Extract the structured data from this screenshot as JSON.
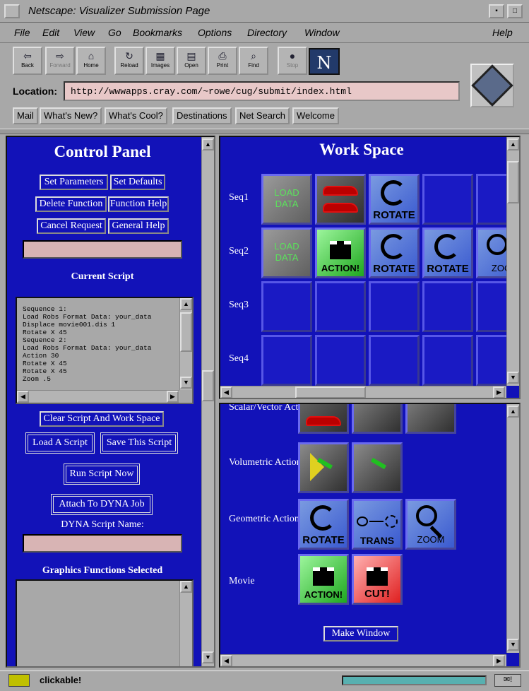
{
  "window": {
    "title": "Netscape: Visualizer Submission Page"
  },
  "menu": [
    "File",
    "Edit",
    "View",
    "Go",
    "Bookmarks",
    "Options",
    "Directory",
    "Window",
    "Help"
  ],
  "toolbar": [
    {
      "label": "Back",
      "icon": "back-arrow-icon",
      "glyph": "⇦"
    },
    {
      "label": "Forward",
      "icon": "forward-arrow-icon",
      "glyph": "⇨"
    },
    {
      "label": "Home",
      "icon": "home-icon",
      "glyph": "⌂"
    },
    {
      "label": "Reload",
      "icon": "reload-icon",
      "glyph": "↻"
    },
    {
      "label": "Images",
      "icon": "images-icon",
      "glyph": "▦"
    },
    {
      "label": "Open",
      "icon": "open-icon",
      "glyph": "▤"
    },
    {
      "label": "Print",
      "icon": "print-icon",
      "glyph": "⎙"
    },
    {
      "label": "Find",
      "icon": "find-icon",
      "glyph": "⌕"
    },
    {
      "label": "Stop",
      "icon": "stop-icon",
      "glyph": "●"
    }
  ],
  "logo": "N",
  "location": {
    "label": "Location:",
    "url": "http://wwwapps.cray.com/~rowe/cug/submit/index.html"
  },
  "directory_buttons": [
    "Mail",
    "What's New?",
    "What's Cool?",
    "Destinations",
    "Net Search",
    "Welcome"
  ],
  "control_panel": {
    "title": "Control Panel",
    "buttons": [
      "Set Parameters",
      "Set Defaults",
      "Delete Function",
      "Function Help",
      "Cancel Request",
      "General Help"
    ],
    "current_script_label": "Current Script",
    "script_lines": "Sequence 1:\nLoad Robs Format Data: your_data\nDisplace movie001.dis 1\nRotate X 45\nSequence 2:\nLoad Robs Format Data: your_data\nAction 30\nRotate X 45\nRotate X 45\nZoom .5",
    "clear_button": "Clear Script And Work Space",
    "load_button": "Load A Script",
    "save_button": "Save This Script",
    "run_button": "Run Script Now",
    "attach_button": "Attach To DYNA Job",
    "dyna_label": "DYNA Script Name:",
    "graphics_label": "Graphics Functions Selected"
  },
  "work_space": {
    "title": "Work Space",
    "sequences": [
      "Seq1",
      "Seq2",
      "Seq3",
      "Seq4"
    ],
    "tile_labels": {
      "load": "LOAD DATA",
      "rotate": "ROTATE",
      "action": "ACTION!",
      "zoom": "ZOO"
    }
  },
  "actions": {
    "scalar_label": "Scalar/Vector Actions",
    "volumetric_label": "Volumetric Actions",
    "geometric_label": "Geometric Actions",
    "movie_label": "Movie",
    "geo_tiles": [
      "ROTATE",
      "TRANS",
      "ZOOM"
    ],
    "movie_tiles": [
      "ACTION!",
      "CUT!"
    ],
    "make_window": "Make Window"
  },
  "status": {
    "text": "clickable!"
  }
}
